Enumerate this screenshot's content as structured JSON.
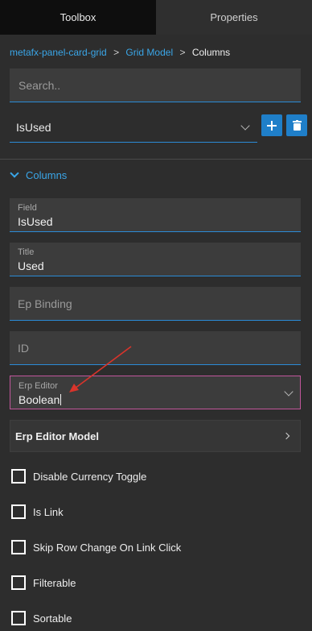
{
  "tabs": [
    {
      "label": "Toolbox",
      "active": true
    },
    {
      "label": "Properties",
      "active": false
    }
  ],
  "breadcrumb": {
    "items": [
      "metafx-panel-card-grid",
      "Grid Model"
    ],
    "separator": ">",
    "current": "Columns"
  },
  "search": {
    "placeholder": "Search..",
    "value": ""
  },
  "column_select": {
    "value": "IsUsed"
  },
  "buttons": {
    "add_icon": "plus-icon",
    "delete_icon": "trash-icon"
  },
  "section": {
    "label": "Columns",
    "expanded": true
  },
  "fields": {
    "field": {
      "label": "Field",
      "value": "IsUsed"
    },
    "title": {
      "label": "Title",
      "value": "Used"
    },
    "ep_binding": {
      "placeholder": "Ep Binding"
    },
    "id": {
      "placeholder": "ID"
    },
    "erp_editor": {
      "label": "Erp Editor",
      "value": "Boolean"
    }
  },
  "erp_editor_model": {
    "label": "Erp Editor Model"
  },
  "checkboxes": [
    {
      "label": "Disable Currency Toggle",
      "checked": false
    },
    {
      "label": "Is Link",
      "checked": false
    },
    {
      "label": "Skip Row Change On Link Click",
      "checked": false
    },
    {
      "label": "Filterable",
      "checked": false
    },
    {
      "label": "Sortable",
      "checked": false
    }
  ],
  "colors": {
    "accent": "#2b8bd6",
    "link": "#3aa6e8",
    "focus_border": "#c1569b",
    "annotation_arrow": "#d9342b"
  }
}
